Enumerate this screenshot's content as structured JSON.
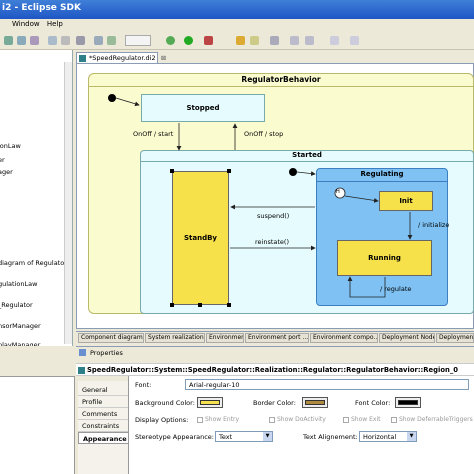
{
  "window": {
    "title": "i2 - Eclipse SDK"
  },
  "menu": [
    "Window",
    "Help"
  ],
  "left_tree": {
    "items": [
      "ionLaw",
      "er",
      "ager",
      "diagram of Regulator",
      "gulationLaw",
      "_Regulator",
      "nsorManager",
      "playManager"
    ]
  },
  "editor": {
    "tab_label": "*SpeedRegulator.di2",
    "tab_close": "⊠",
    "region_title": "RegulatorBehavior",
    "states": {
      "stopped": "Stopped",
      "started": "Started",
      "standby": "StandBy",
      "regulating": "Regulating",
      "init": "Init",
      "running": "Running",
      "history": "H"
    },
    "transitions": {
      "onoff_start": "OnOff / start",
      "onoff_stop": "OnOff / stop",
      "suspend": "suspend()",
      "reinstate": "reinstate()",
      "initialize": "/ initialize",
      "regulate": "/ regulate"
    },
    "colors": {
      "region": "#fbfbd0",
      "state": "#e6fbfd",
      "yellow_state": "#f7e14a",
      "regulating": "#7ec1f2"
    }
  },
  "bottom_tabs": [
    "Component diagram...",
    "System realization",
    "Environment",
    "Environment port ...",
    "Environment compo...",
    "Deployment Nodes",
    "Deployment d"
  ],
  "properties": {
    "header": "Properties",
    "path": "SpeedRegulator::System::SpeedRegulator::Realization::Regulator::RegulatorBehavior::Region_0",
    "tabs": [
      "General",
      "Profile",
      "Comments",
      "Constraints",
      "Appearance"
    ],
    "active_tab": "Appearance",
    "font_label": "Font:",
    "font_value": "Arial-regular-10",
    "background_color_label": "Background Color:",
    "border_color_label": "Border Color:",
    "font_color_label": "Font Color:",
    "display_options_label": "Display Options:",
    "show_entry": "Show Entry",
    "show_do_activity": "Show DoActivity",
    "show_exit": "Show Exit",
    "show_deferrable": "Show DeferrableTriggers",
    "stereotype_label": "Stereotype Appearance:",
    "stereotype_value": "Text",
    "text_alignment_label": "Text Alignement:",
    "text_alignment_value": "Horizontal",
    "swatches": {
      "background": "#f5e14e",
      "border": "#b08a3e",
      "font": "#000000"
    }
  }
}
